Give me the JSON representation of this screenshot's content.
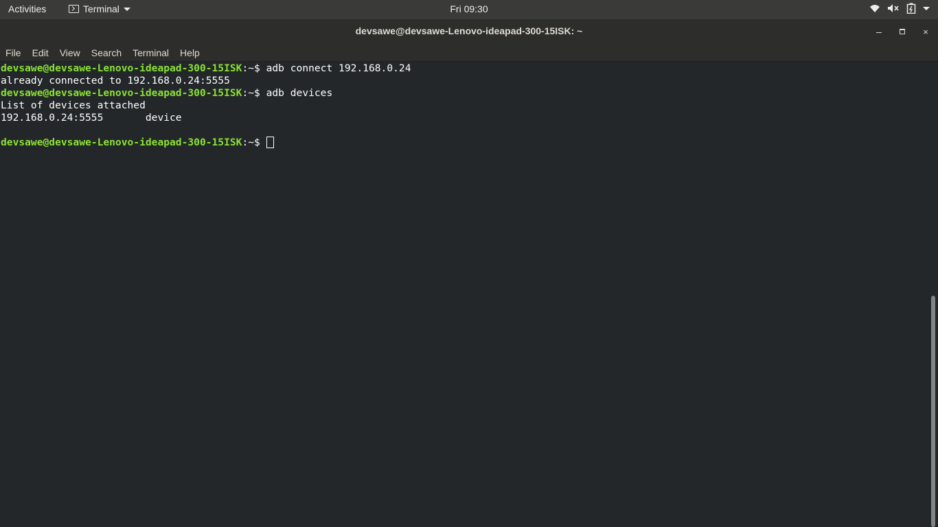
{
  "topbar": {
    "activities": "Activities",
    "app_menu": "Terminal",
    "clock": "Fri 09:30",
    "tray_icons": [
      "wifi-icon",
      "volume-muted-icon",
      "battery-icon",
      "system-menu-caret-icon"
    ]
  },
  "window": {
    "title": "devsawe@devsawe-Lenovo-ideapad-300-15ISK: ~",
    "minimize": "minimize",
    "maximize": "maximize",
    "close_glyph": "×"
  },
  "menubar": {
    "file": "File",
    "edit": "Edit",
    "view": "View",
    "search": "Search",
    "terminal": "Terminal",
    "help": "Help"
  },
  "terminal": {
    "prompt_user": "devsawe@devsawe-Lenovo-ideapad-300-15ISK",
    "prompt_path": ":~$ ",
    "cmd1": "adb connect 192.168.0.24",
    "out1": "already connected to 192.168.0.24:5555",
    "cmd2": "adb devices",
    "out2": "List of devices attached",
    "out3": "192.168.0.24:5555\tdevice",
    "out4": ""
  },
  "colors": {
    "prompt_green": "#8ae234",
    "terminal_bg": "#232729",
    "topbar_bg": "#3a3a38"
  }
}
